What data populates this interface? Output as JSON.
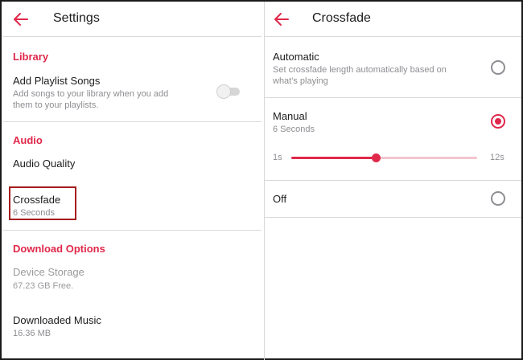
{
  "left_panel": {
    "header": {
      "title": "Settings",
      "back_icon": "arrow-left-icon"
    },
    "library": {
      "section_title": "Library",
      "add_playlist_songs": {
        "title": "Add Playlist Songs",
        "subtitle_line1": "Add songs to your library when you add",
        "subtitle_line2": "them to your playlists.",
        "toggle_on": false
      }
    },
    "audio": {
      "section_title": "Audio",
      "audio_quality": {
        "title": "Audio Quality"
      },
      "crossfade": {
        "title": "Crossfade",
        "subtitle": "6 Seconds"
      }
    },
    "download": {
      "section_title": "Download Options",
      "device_storage": {
        "title": "Device Storage",
        "subtitle": "67.23 GB Free."
      },
      "downloaded_music": {
        "title": "Downloaded Music",
        "subtitle": "16.36 MB"
      }
    }
  },
  "right_panel": {
    "header": {
      "title": "Crossfade",
      "back_icon": "arrow-left-icon"
    },
    "automatic": {
      "title": "Automatic",
      "subtitle_line1": "Set crossfade length automatically based on",
      "subtitle_line2": "what's playing",
      "selected": false
    },
    "manual": {
      "title": "Manual",
      "subtitle": "6 Seconds",
      "selected": true
    },
    "slider": {
      "min_label": "1s",
      "max_label": "12s",
      "value_fraction": 0.455
    },
    "off": {
      "title": "Off",
      "selected": false
    }
  },
  "colors": {
    "accent": "#e0284a",
    "highlight_box": "#a31d1d",
    "subtext": "#8e8e93"
  }
}
